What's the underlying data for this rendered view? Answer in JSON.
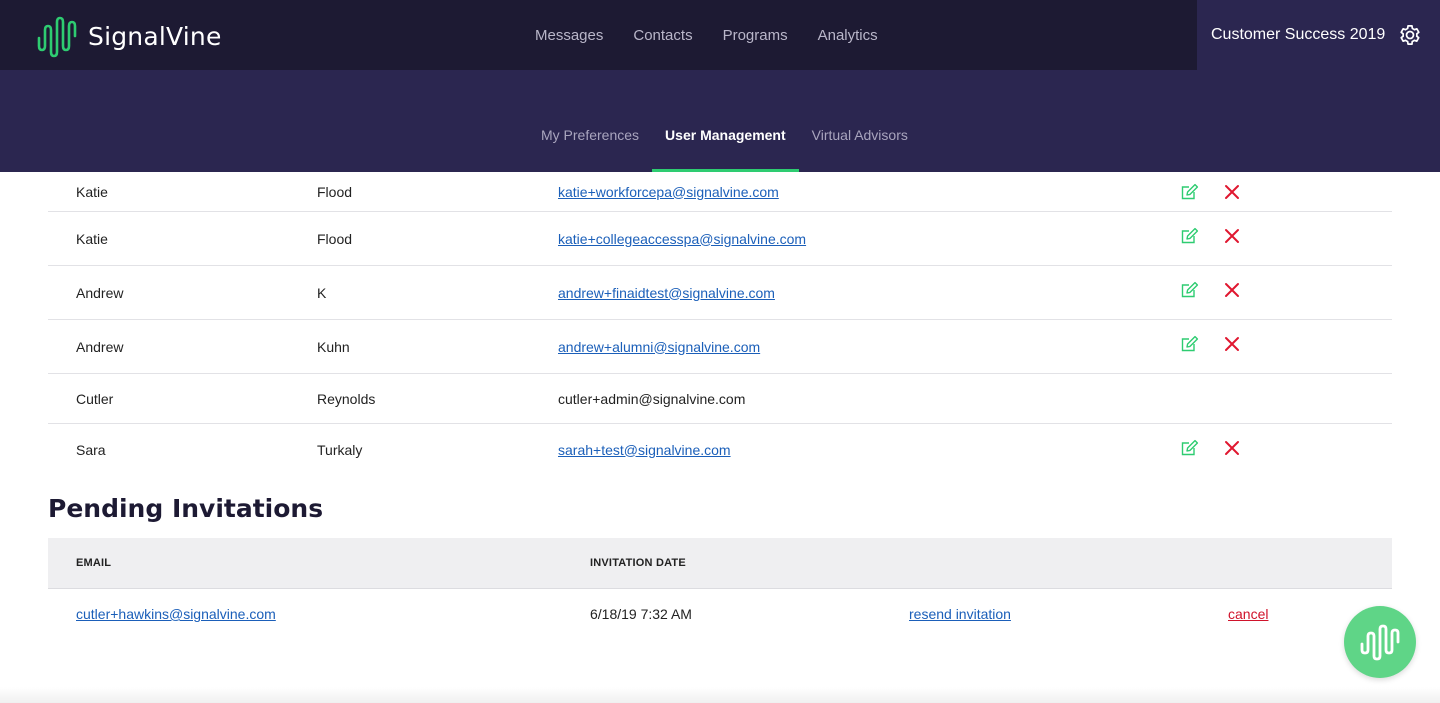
{
  "brand": {
    "name": "SignalVine",
    "logo_icon": "signal-wave-icon",
    "accent": "#2ecc71"
  },
  "main_nav": {
    "items": [
      {
        "label": "Messages"
      },
      {
        "label": "Contacts"
      },
      {
        "label": "Programs"
      },
      {
        "label": "Analytics"
      }
    ]
  },
  "org": {
    "name": "Customer Success 2019",
    "settings_icon": "gear-icon"
  },
  "sub_nav": {
    "tabs": [
      {
        "label": "My Preferences",
        "active": false
      },
      {
        "label": "User Management",
        "active": true
      },
      {
        "label": "Virtual Advisors",
        "active": false
      }
    ]
  },
  "users": {
    "rows": [
      {
        "first": "Katie",
        "last": "Flood",
        "email": "katie+workforcepa@signalvine.com",
        "editable": true
      },
      {
        "first": "Katie",
        "last": "Flood",
        "email": "katie+collegeaccesspa@signalvine.com",
        "editable": true
      },
      {
        "first": "Andrew",
        "last": "K",
        "email": "andrew+finaidtest@signalvine.com",
        "editable": true
      },
      {
        "first": "Andrew",
        "last": "Kuhn",
        "email": "andrew+alumni@signalvine.com",
        "editable": true
      },
      {
        "first": "Cutler",
        "last": "Reynolds",
        "email": "cutler+admin@signalvine.com",
        "editable": false
      },
      {
        "first": "Sara",
        "last": "Turkaly",
        "email": "sarah+test@signalvine.com",
        "editable": true
      }
    ],
    "edit_icon": "edit-pencil-icon",
    "delete_icon": "close-x-icon",
    "edit_color": "#2ecc71",
    "delete_color": "#e0172f"
  },
  "pending": {
    "title": "Pending Invitations",
    "columns": {
      "email": "EMAIL",
      "date": "INVITATION DATE"
    },
    "rows": [
      {
        "email": "cutler+hawkins@signalvine.com",
        "date": "6/18/19 7:32 AM",
        "resend_label": "resend invitation",
        "cancel_label": "cancel"
      }
    ]
  },
  "chat": {
    "icon": "signal-wave-icon",
    "color": "#5fd587"
  }
}
